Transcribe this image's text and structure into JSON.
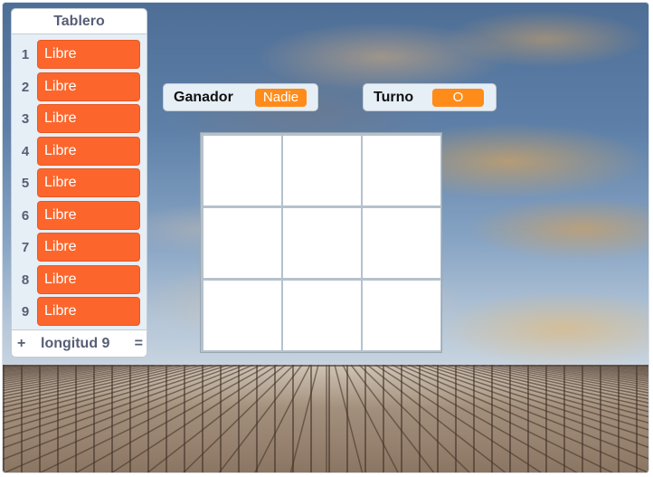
{
  "list_monitor": {
    "title": "Tablero",
    "items": [
      {
        "index": "1",
        "value": "Libre"
      },
      {
        "index": "2",
        "value": "Libre"
      },
      {
        "index": "3",
        "value": "Libre"
      },
      {
        "index": "4",
        "value": "Libre"
      },
      {
        "index": "5",
        "value": "Libre"
      },
      {
        "index": "6",
        "value": "Libre"
      },
      {
        "index": "7",
        "value": "Libre"
      },
      {
        "index": "8",
        "value": "Libre"
      },
      {
        "index": "9",
        "value": "Libre"
      }
    ],
    "footer": {
      "add_label": "+",
      "length_label": "longitud 9",
      "resize_label": "="
    }
  },
  "monitors": {
    "ganador": {
      "label": "Ganador",
      "value": "Nadie"
    },
    "turno": {
      "label": "Turno",
      "value": "O"
    }
  },
  "board": {
    "cells": [
      "",
      "",
      "",
      "",
      "",
      "",
      "",
      "",
      ""
    ]
  },
  "colors": {
    "list_item": "#fc662c",
    "variable_value": "#ff8c1a",
    "monitor_bg": "#e6eef6"
  }
}
